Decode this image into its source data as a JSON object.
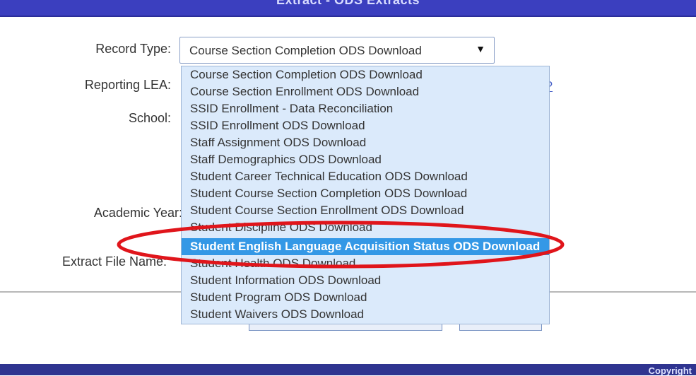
{
  "header": {
    "title": "Extract - ODS Extracts"
  },
  "form": {
    "record_type_label": "Record Type:",
    "reporting_lea_label": "Reporting LEA:",
    "school_label": "School:",
    "academic_year_label": "Academic Year:",
    "extract_file_name_label": "Extract File Name:",
    "record_type_value": "Course Section Completion ODS Download"
  },
  "dropdown": {
    "options": [
      "Course Section Completion ODS Download",
      "Course Section Enrollment ODS Download",
      "SSID Enrollment - Data Reconciliation",
      "SSID Enrollment ODS Download",
      "Staff Assignment ODS Download",
      "Staff Demographics ODS Download",
      "Student Career Technical Education ODS Download",
      "Student Course Section Completion ODS Download",
      "Student Course Section Enrollment ODS Download",
      "Student Discipline ODS Download",
      "Student English Language Acquisition Status ODS Download",
      "Student Health ODS Download",
      "Student Information ODS Download",
      "Student Program ODS Download",
      "Student Waivers ODS Download"
    ],
    "highlighted_index": 10
  },
  "footer": {
    "copyright": "Copyright"
  },
  "annotation": {
    "color": "#e0151b"
  },
  "icons": {
    "dropdown_arrow": "dropdown-arrow-icon"
  }
}
